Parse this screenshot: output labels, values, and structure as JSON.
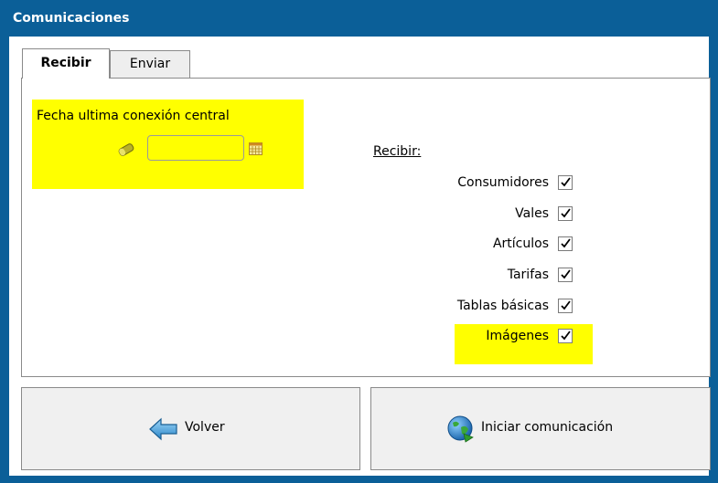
{
  "window": {
    "title": "Comunicaciones"
  },
  "tabs": [
    {
      "label": "Recibir",
      "active": true
    },
    {
      "label": "Enviar",
      "active": false
    }
  ],
  "left_panel": {
    "fecha_label": "Fecha ultima conexión central",
    "fecha_value": "",
    "icons": [
      "eraser-icon",
      "calendar-icon"
    ]
  },
  "right_panel": {
    "heading": "Recibir:",
    "options": [
      {
        "label": "Consumidores",
        "checked": true
      },
      {
        "label": "Vales",
        "checked": true
      },
      {
        "label": "Artículos",
        "checked": true
      },
      {
        "label": "Tarifas",
        "checked": true
      },
      {
        "label": "Tablas básicas",
        "checked": true
      },
      {
        "label": "Imágenes",
        "checked": true
      }
    ]
  },
  "buttons": {
    "volver": {
      "label": "Volver",
      "icon": "back-arrow-icon"
    },
    "iniciar": {
      "label": "Iniciar comunicación",
      "icon": "globe-icon"
    }
  },
  "colors": {
    "titlebar": "#0b5f98",
    "highlight": "#ffff00",
    "button_bg": "#f0f0f0"
  }
}
